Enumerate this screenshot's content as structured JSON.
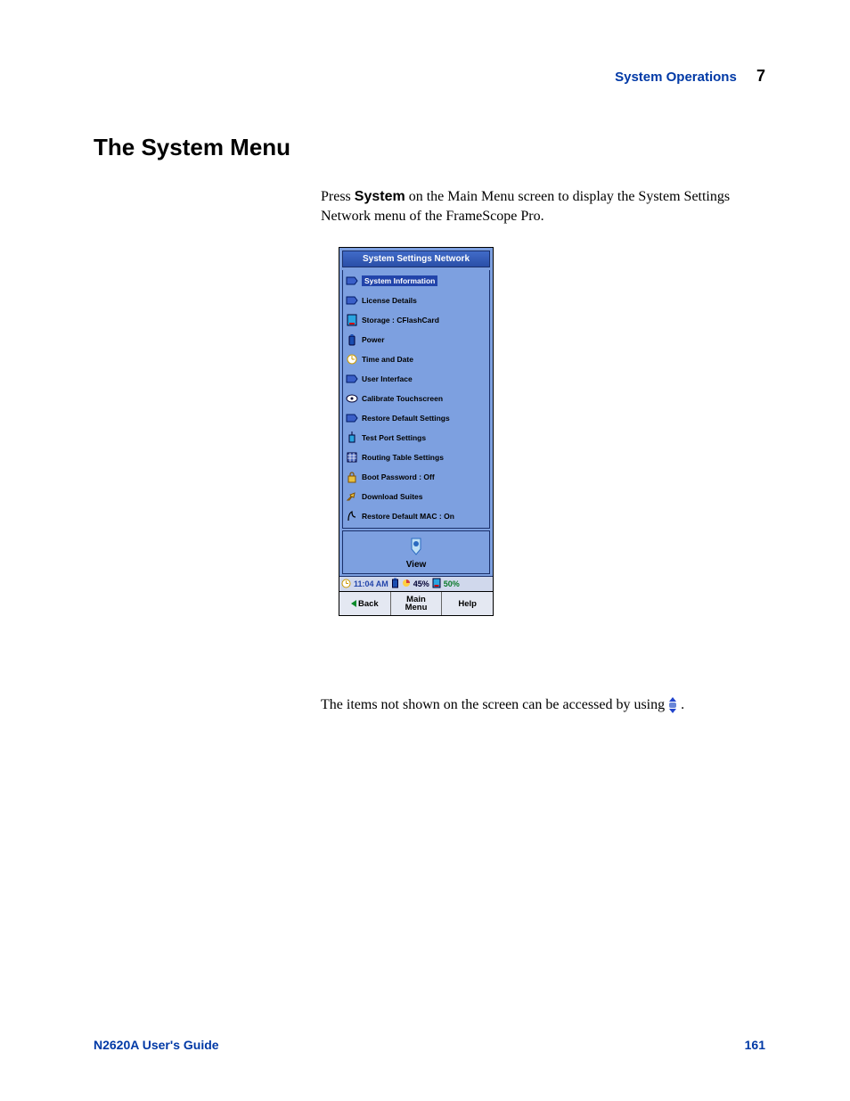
{
  "header": {
    "section": "System Operations",
    "chapter": "7"
  },
  "title": "The System Menu",
  "paragraph1_pre": "Press ",
  "paragraph1_bold": "System",
  "paragraph1_post": " on the Main Menu screen to display the System Settings Network menu of the FrameScope Pro.",
  "paragraph2_pre": "The items not shown on the screen can be accessed by using ",
  "paragraph2_post": ".",
  "footer": {
    "left": "N2620A User's Guide",
    "page": "161"
  },
  "device": {
    "title": "System Settings Network",
    "items": [
      {
        "label": "System Information",
        "icon": "info",
        "selected": true
      },
      {
        "label": "License Details",
        "icon": "license"
      },
      {
        "label": "Storage : CFlashCard",
        "icon": "storage"
      },
      {
        "label": "Power",
        "icon": "power"
      },
      {
        "label": "Time and Date",
        "icon": "clock"
      },
      {
        "label": "User Interface",
        "icon": "ui"
      },
      {
        "label": "Calibrate Touchscreen",
        "icon": "calibrate"
      },
      {
        "label": "Restore Default Settings",
        "icon": "restore"
      },
      {
        "label": "Test Port Settings",
        "icon": "port"
      },
      {
        "label": "Routing Table Settings",
        "icon": "routing"
      },
      {
        "label": "Boot Password : Off",
        "icon": "lock"
      },
      {
        "label": "Download Suites",
        "icon": "download"
      },
      {
        "label": "Restore Default MAC : On",
        "icon": "mac"
      }
    ],
    "view_label": "View",
    "status": {
      "time": "11:04 AM",
      "battery_pct": "45%",
      "storage_pct": "50%"
    },
    "buttons": {
      "back": "Back",
      "main": "Main\nMenu",
      "help": "Help"
    }
  }
}
